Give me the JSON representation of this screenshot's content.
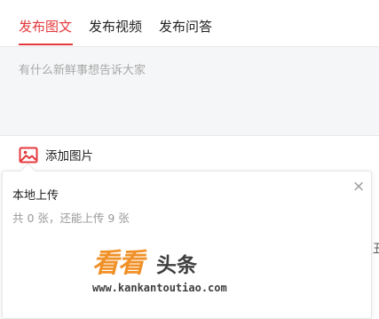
{
  "tabs": [
    {
      "label": "发布图文",
      "active": true
    },
    {
      "label": "发布视频",
      "active": false
    },
    {
      "label": "发布问答",
      "active": false
    }
  ],
  "editor": {
    "placeholder": "有什么新鲜事想告诉大家"
  },
  "toolbar": {
    "add_image_label": "添加图片",
    "icon": "image-icon"
  },
  "upload_popup": {
    "title": "本地上传",
    "subtitle": "共 0 张，还能上传 9 张",
    "close_icon": "close-icon",
    "close_glyph": "×"
  },
  "edge_text": "丑",
  "watermark": {
    "brand_part1": "看看",
    "brand_part2": "头条",
    "url": "www.kankantoutiao.com"
  },
  "colors": {
    "accent": "#e4393c",
    "editor_bg": "#f5f6f7",
    "watermark_orange": "#f09128",
    "watermark_dark": "#3f3f3f"
  }
}
